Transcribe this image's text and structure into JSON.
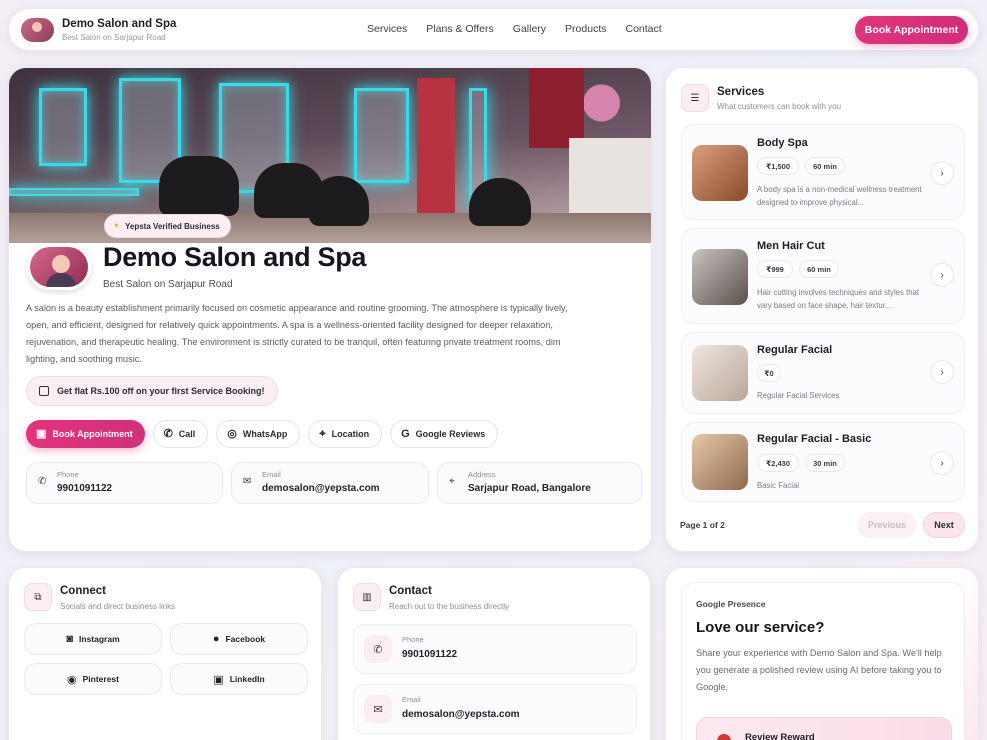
{
  "header": {
    "brand_title": "Demo Salon and Spa",
    "brand_subtitle": "Best Salon on Sarjapur Road",
    "nav": [
      "Services",
      "Plans & Offers",
      "Gallery",
      "Products",
      "Contact"
    ],
    "cta": "Book Appointment"
  },
  "profile": {
    "verified_badge": "Yepsta Verified Business",
    "title": "Demo Salon and Spa",
    "subtitle": "Best Salon on Sarjapur Road",
    "description": "A salon is a beauty establishment primarily focused on cosmetic appearance and routine grooming. The atmosphere is typically lively, open, and efficient, designed for relatively quick appointments. A spa is a wellness-oriented facility designed for deeper relaxation, rejuvenation, and therapeutic healing. The environment is strictly curated to be tranquil, often featuring private treatment rooms, dim lighting, and soothing music.",
    "offer": "Get flat Rs.100 off on your first Service Booking!",
    "actions": {
      "book": "Book Appointment",
      "call": "Call",
      "whatsapp": "WhatsApp",
      "location": "Location",
      "reviews": "Google Reviews"
    },
    "info": {
      "phone_label": "Phone",
      "phone": "9901091122",
      "email_label": "Email",
      "email": "demosalon@yepsta.com",
      "address_label": "Address",
      "address": "Sarjapur Road, Bangalore"
    }
  },
  "services": {
    "title": "Services",
    "subtitle": "What customers can book with you",
    "items": [
      {
        "name": "Body Spa",
        "price": "₹1,500",
        "duration": "60 min",
        "desc": "A body spa is a non-medical wellness treatment designed to improve physical..."
      },
      {
        "name": "Men Hair Cut",
        "price": "₹999",
        "duration": "60 min",
        "desc": "Hair cutting involves techniques and styles that vary based on face shape, hair textur..."
      },
      {
        "name": "Regular Facial",
        "price": "₹0",
        "duration": "",
        "desc": "Regular Facial Services"
      },
      {
        "name": "Regular Facial - Basic",
        "price": "₹2,430",
        "duration": "30 min",
        "desc": "Basic Facial"
      }
    ],
    "page": "Page 1 of 2",
    "prev": "Previous",
    "next": "Next"
  },
  "connect": {
    "title": "Connect",
    "subtitle": "Socials and direct business links",
    "links": [
      "Instagram",
      "Facebook",
      "Pinterest",
      "LinkedIn"
    ]
  },
  "contact": {
    "title": "Contact",
    "subtitle": "Reach out to the business directly",
    "phone_label": "Phone",
    "phone": "9901091122",
    "email_label": "Email",
    "email": "demosalon@yepsta.com"
  },
  "google": {
    "kicker": "Google Presence",
    "title": "Love our service?",
    "text": "Share your experience with Demo Salon and Spa. We'll help you generate a polished review using AI before taking you to Google.",
    "reward": "Review Reward"
  },
  "colors": {
    "accent": "#e0347c",
    "soft_pink": "#fbeff4",
    "glow": "#39d9e6"
  }
}
